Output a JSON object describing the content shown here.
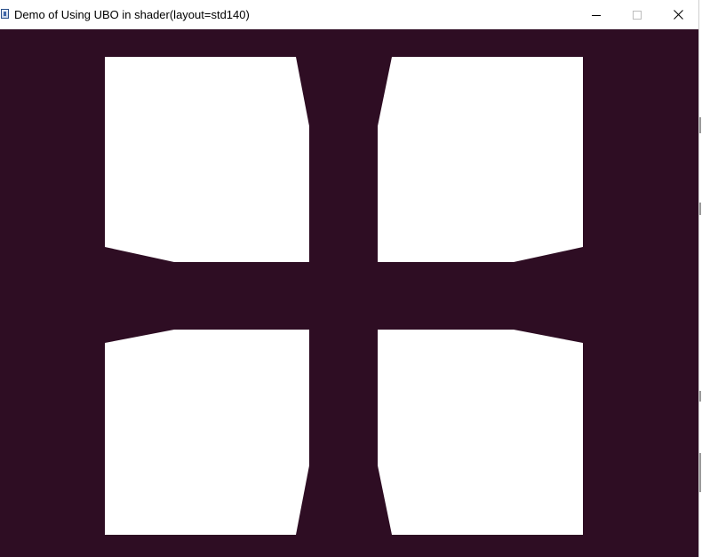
{
  "window": {
    "title": "Demo of Using UBO in shader(layout=std140)",
    "icon": "app-window-icon",
    "controls": {
      "minimize_icon": "minimize-icon",
      "maximize_icon": "maximize-icon",
      "close_icon": "close-icon"
    }
  },
  "render": {
    "clear_color": "#2e0d23",
    "shape_color": "#ffffff",
    "shapes": [
      "top-left",
      "top-right",
      "bottom-left",
      "bottom-right"
    ]
  }
}
